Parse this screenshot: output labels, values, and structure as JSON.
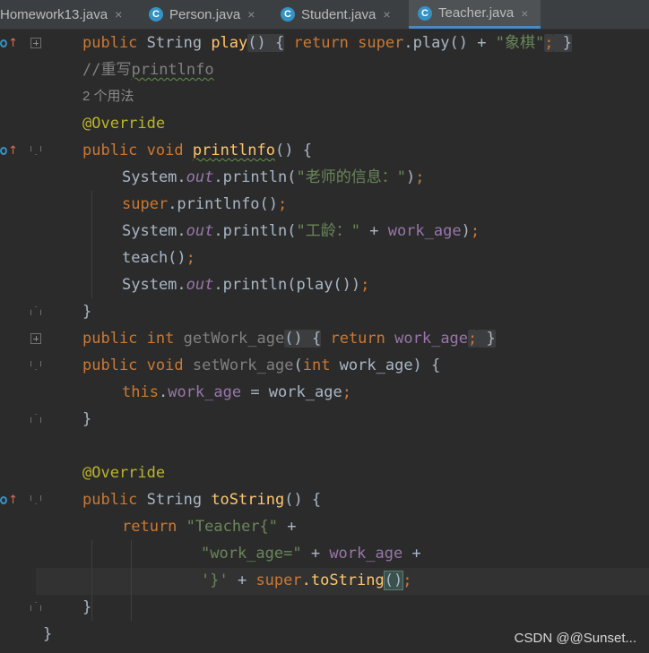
{
  "tabs": [
    {
      "label": "Homework13.java",
      "close": "×",
      "icon": ""
    },
    {
      "label": "Person.java",
      "close": "×",
      "icon": "C"
    },
    {
      "label": "Student.java",
      "close": "×",
      "icon": "C"
    },
    {
      "label": "Teacher.java",
      "close": "×",
      "icon": "C",
      "active": true
    }
  ],
  "code": {
    "l1": {
      "kw": "public",
      "type": " String ",
      "name": "play",
      "paren": "()",
      "sp": " ",
      "open": "{",
      "sp2": " ",
      "ret": "return",
      "sp3": " ",
      "sup": "super",
      "rest": ".play() + ",
      "str": "\"象棋\"",
      "semi": ";",
      "sp4": " ",
      "close": "}"
    },
    "l2": {
      "comment_a": "//重写",
      "comment_b": "printlnfo"
    },
    "l3": {
      "hint": "2 个用法"
    },
    "l4": {
      "ann": "@Override"
    },
    "l5": {
      "kw": "public",
      "sp": " ",
      "kw2": "void",
      "sp2": " ",
      "name": "printlnfo",
      "rest": "() {"
    },
    "l6": {
      "sys": "System.",
      "out": "out",
      "mid": ".println(",
      "str": "\"老师的信息：\"",
      "end": ")",
      "semi": ";"
    },
    "l7": {
      "sup": "super",
      "rest": ".printlnfo()",
      "semi": ";"
    },
    "l8": {
      "sys": "System.",
      "out": "out",
      "mid": ".println(",
      "str": "\"工龄：\"",
      "plus": " + ",
      "field": "work_age",
      "end": ")",
      "semi": ";"
    },
    "l9": {
      "call": "teach()",
      "semi": ";"
    },
    "l10": {
      "sys": "System.",
      "out": "out",
      "mid": ".println(play())",
      "semi": ";"
    },
    "l11": {
      "close": "}"
    },
    "l12": {
      "kw": "public",
      "sp": " ",
      "kw2": "int",
      "sp2": " ",
      "name": "getWork_age",
      "paren": "()",
      "sp3": " ",
      "open": "{",
      "sp4": " ",
      "ret": "return",
      "sp5": " ",
      "field": "work_age",
      "semi": ";",
      "sp6": " ",
      "close": "}"
    },
    "l13": {
      "kw": "public",
      "sp": " ",
      "kw2": "void",
      "sp2": " ",
      "name": "setWork_age",
      "p1": "(",
      "kw3": "int",
      "p2": " work_age) {"
    },
    "l14": {
      "this": "this",
      "dot": ".",
      "field": "work_age",
      "rest": " = work_age",
      "semi": ";"
    },
    "l15": {
      "close": "}"
    },
    "l17": {
      "ann": "@Override"
    },
    "l18": {
      "kw": "public",
      "type": " String ",
      "name": "toString",
      "rest": "() {"
    },
    "l19": {
      "ret": "return",
      "sp": " ",
      "str": "\"Teacher{\"",
      "rest": " +"
    },
    "l20": {
      "str": "\"work_age=\"",
      "plus": " + ",
      "field": "work_age",
      "rest": " +"
    },
    "l21": {
      "str": "'}'",
      "plus": " + ",
      "sup": "super",
      "mid": ".toString",
      "paren": "()",
      "semi": ";"
    },
    "l22": {
      "close": "}"
    },
    "l23": {
      "close": "}"
    }
  },
  "watermark": "CSDN @@Sunset..."
}
